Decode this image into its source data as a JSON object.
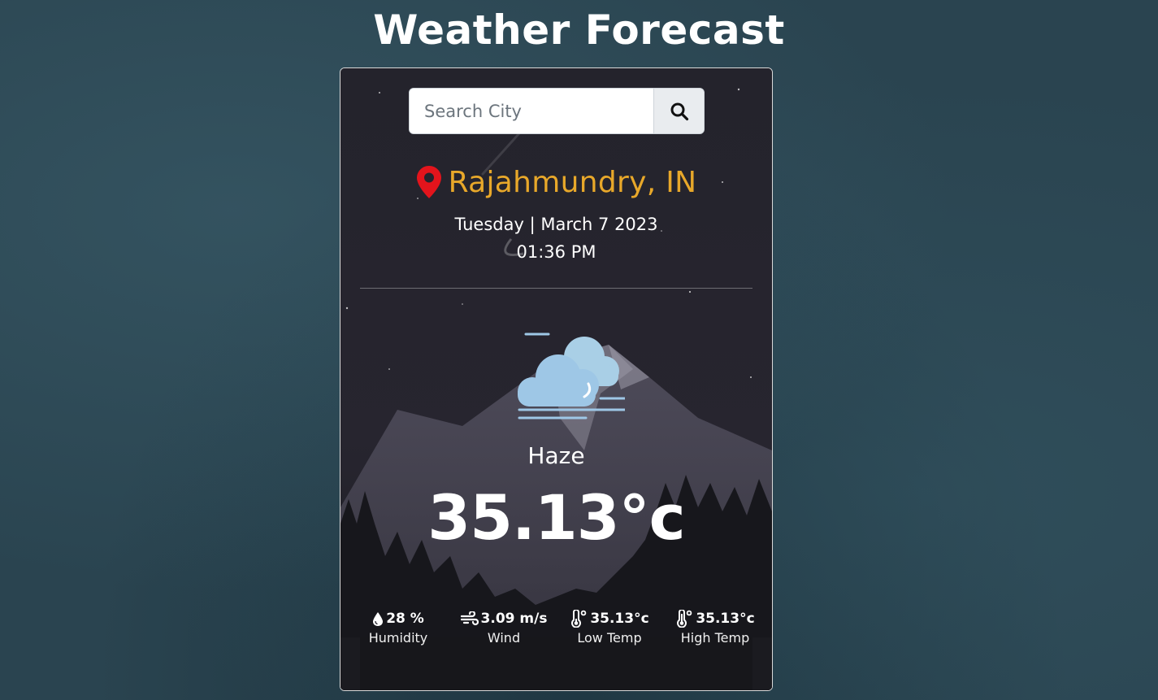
{
  "app": {
    "title": "Weather Forecast"
  },
  "search": {
    "placeholder": "Search City",
    "value": ""
  },
  "location": {
    "city": "Rajahmundry, IN"
  },
  "datetime": {
    "date": "Tuesday | March 7 2023",
    "time": "01:36 PM"
  },
  "weather": {
    "condition": "Haze",
    "temperature": "35.13°c",
    "icon": "haze-cloud-icon"
  },
  "stats": {
    "humidity": {
      "value": "28 %",
      "label": "Humidity",
      "icon": "droplet-icon"
    },
    "wind": {
      "value": "3.09 m/s",
      "label": "Wind",
      "icon": "wind-icon"
    },
    "low_temp": {
      "value": "35.13°c",
      "label": "Low Temp",
      "icon": "thermometer-low-icon"
    },
    "high_temp": {
      "value": "35.13°c",
      "label": "High Temp",
      "icon": "thermometer-high-icon"
    }
  },
  "colors": {
    "city": "#e8a82a",
    "pin": "#e3141c",
    "page_bg": "#2a4450",
    "card_bg": "#25242e"
  }
}
